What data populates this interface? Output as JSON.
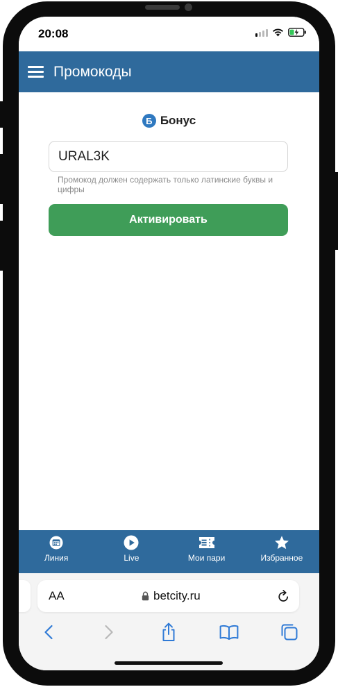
{
  "status_bar": {
    "time": "20:08",
    "icons": [
      "cellular-signal-icon",
      "wifi-icon",
      "battery-charging-icon"
    ]
  },
  "header": {
    "menu_icon": "hamburger-menu-icon",
    "title": "Промокоды",
    "background_color": "#2f6a9c"
  },
  "bonus": {
    "badge_letter": "Б",
    "label": "Бонус"
  },
  "promo": {
    "input_value": "URAL3K",
    "hint": "Промокод должен содержать только латинские буквы и цифры",
    "button_label": "Активировать",
    "button_color": "#3f9d58"
  },
  "bottom_nav": {
    "items": [
      {
        "label": "Линия",
        "icon": "calendar-icon"
      },
      {
        "label": "Live",
        "icon": "play-circle-icon"
      },
      {
        "label": "Мои пари",
        "icon": "ticket-icon"
      },
      {
        "label": "Избранное",
        "icon": "star-icon"
      }
    ]
  },
  "browser": {
    "text_size_label": "AA",
    "url": "betcity.ru",
    "toolbar": [
      "back-icon",
      "forward-icon",
      "share-icon",
      "bookmarks-icon",
      "tabs-icon"
    ]
  }
}
